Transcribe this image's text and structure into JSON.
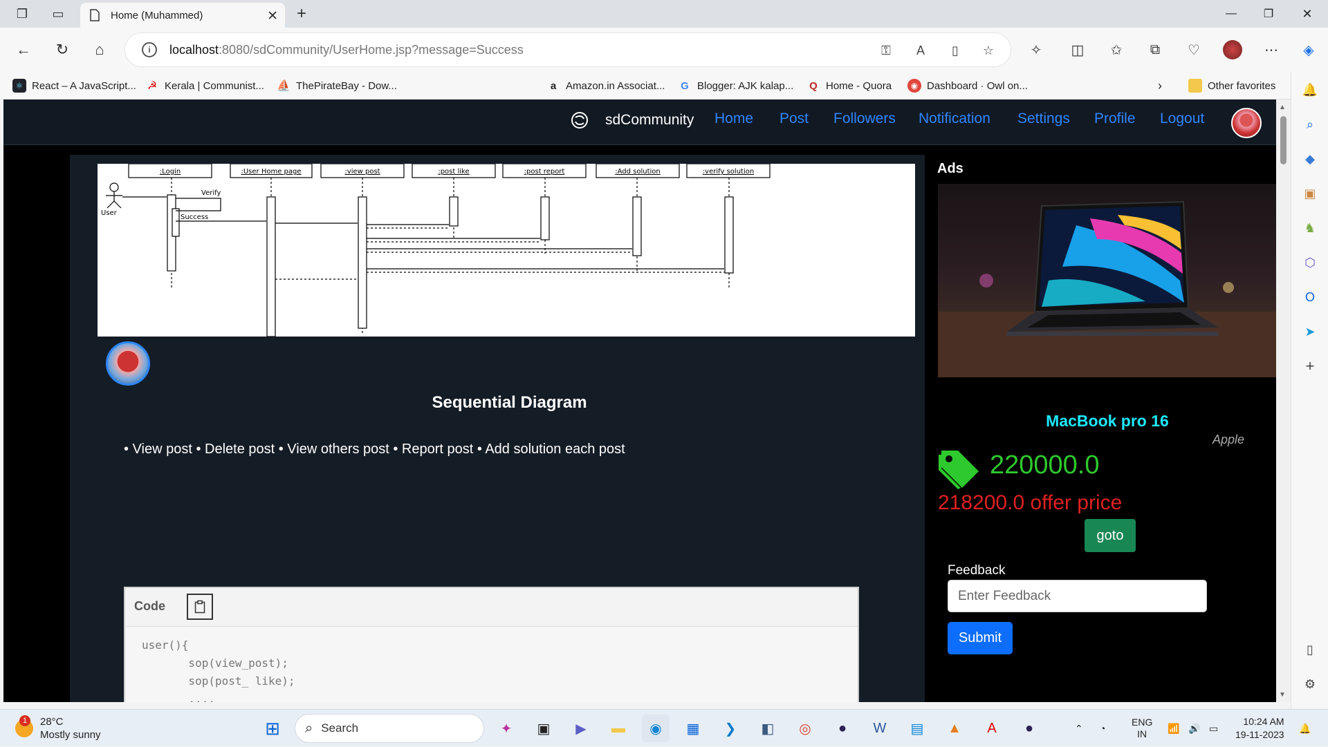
{
  "browser": {
    "tab_title": "Home (Muhammed)",
    "url_host": "localhost",
    "url_path": ":8080/sdCommunity/UserHome.jsp?message=Success",
    "bookmarks": [
      {
        "label": "React – A JavaScript..."
      },
      {
        "label": "Kerala | Communist..."
      },
      {
        "label": "ThePirateBay - Dow..."
      },
      {
        "label": "Amazon.in Associat..."
      },
      {
        "label": "Blogger: AJK kalap..."
      },
      {
        "label": "Home - Quora"
      },
      {
        "label": "Dashboard · Owl on..."
      }
    ],
    "other_favorites": "Other favorites"
  },
  "nav": {
    "brand": "sdCommunity",
    "links": [
      "Home",
      "Post",
      "Followers",
      "Notification",
      "Settings",
      "Profile",
      "Logout"
    ]
  },
  "post": {
    "title": "Sequential Diagram",
    "list": "• View post • Delete post • View others post • Report post • Add solution each post",
    "code_label": "Code",
    "code": "user(){\n       sop(view_post);\n       sop(post_ like);\n       ....\n      sop(verify_solution);\n}",
    "diagram": {
      "lifelines": [
        ":Login",
        ":User Home page",
        ":view post",
        ":post like",
        ":post report",
        ":Add solution",
        ":verify solution"
      ],
      "actor": "User",
      "messages": [
        "Verify",
        "Success"
      ]
    }
  },
  "ads": {
    "heading": "Ads",
    "product": "MacBook pro 16",
    "brand": "Apple",
    "price": "220000.0",
    "offer": "218200.0 offer price",
    "goto": "goto",
    "feedback_label": "Feedback",
    "feedback_placeholder": "Enter Feedback",
    "submit": "Submit"
  },
  "taskbar": {
    "temp": "28°C",
    "weather": "Mostly sunny",
    "weather_badge": "1",
    "search": "Search",
    "lang1": "ENG",
    "lang2": "IN",
    "time": "10:24 AM",
    "date": "19-11-2023"
  }
}
